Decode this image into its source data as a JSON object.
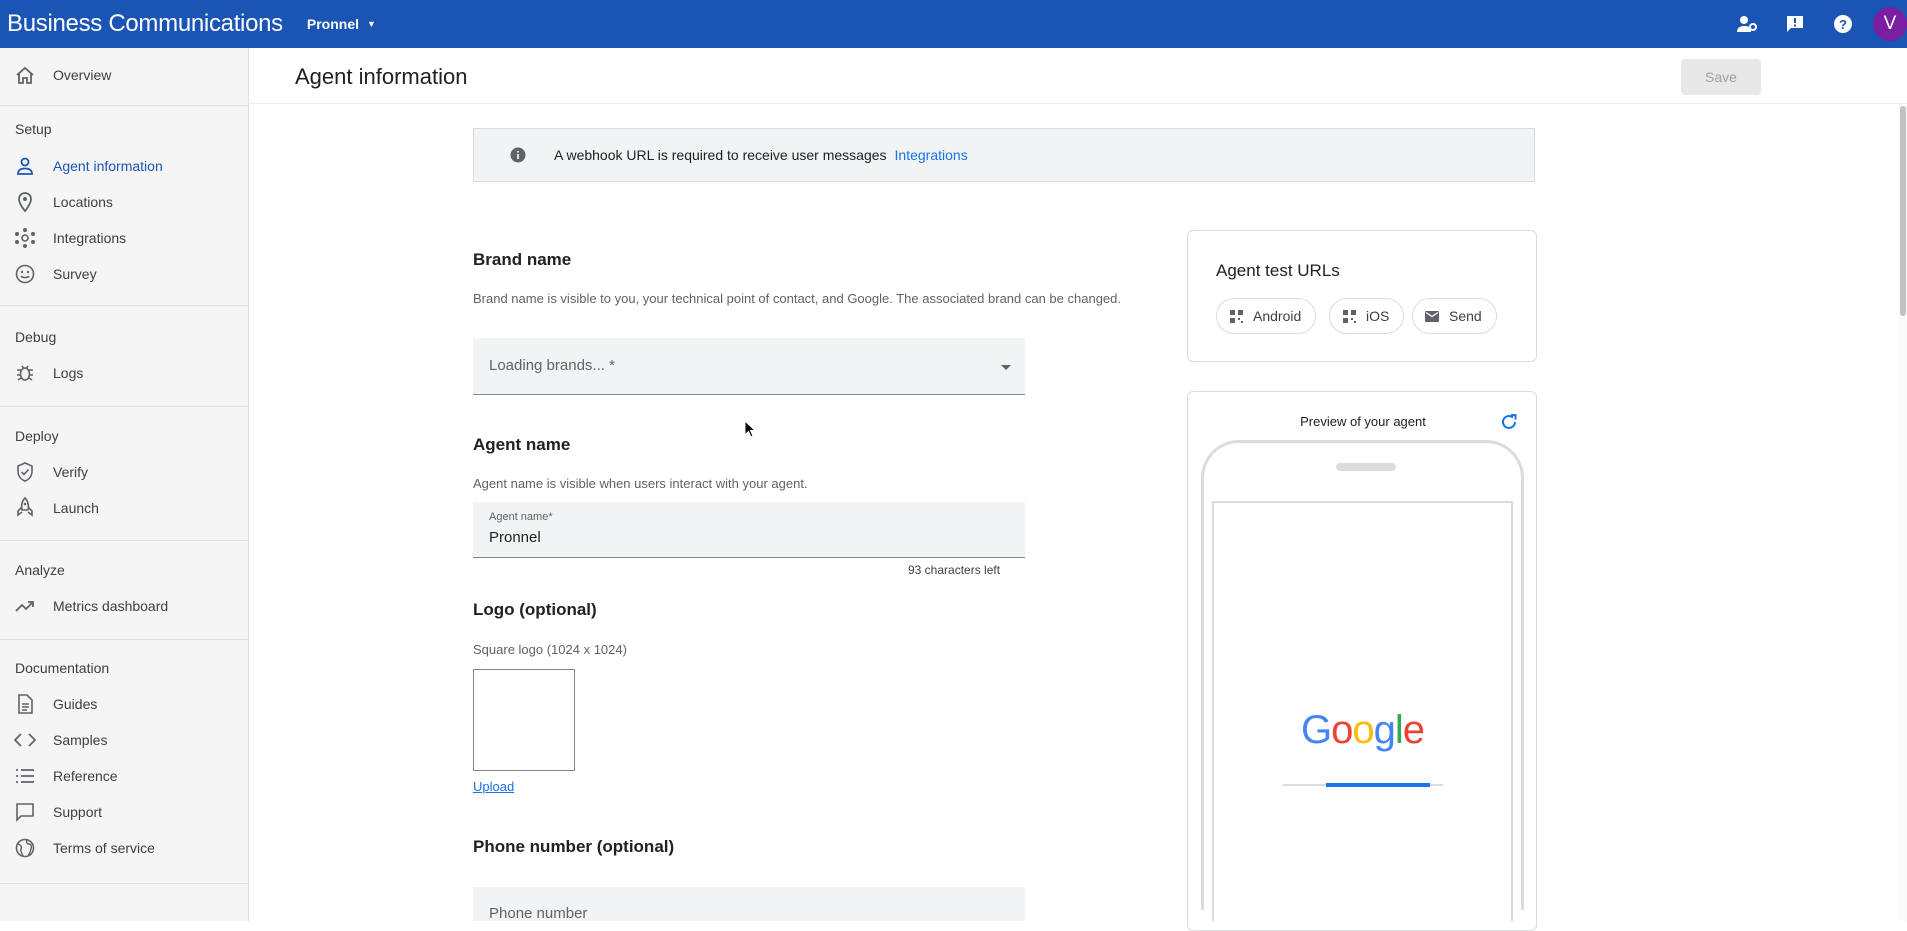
{
  "app": {
    "title": "Business Communications",
    "account": "Pronnel",
    "avatar_letter": "V",
    "brand_color": "#1a55b5",
    "top_icons": [
      "manage-accounts-icon",
      "feedback-icon",
      "help-icon"
    ]
  },
  "sidebar": {
    "overview": "Overview",
    "setup_header": "Setup",
    "setup_items": [
      "Agent information",
      "Locations",
      "Integrations",
      "Survey"
    ],
    "debug_header": "Debug",
    "debug_items": [
      "Logs"
    ],
    "deploy_header": "Deploy",
    "deploy_items": [
      "Verify",
      "Launch"
    ],
    "analyze_header": "Analyze",
    "analyze_items": [
      "Metrics dashboard"
    ],
    "docs_header": "Documentation",
    "docs_items": [
      "Guides",
      "Samples",
      "Reference",
      "Support",
      "Terms of service"
    ],
    "active_item": "Agent information"
  },
  "header": {
    "title": "Agent information",
    "save_label": "Save"
  },
  "banner": {
    "message": "A webhook URL is required to receive user messages",
    "link": "Integrations"
  },
  "brand": {
    "heading": "Brand name",
    "description": "Brand name is visible to you, your technical point of contact, and Google. The associated brand can be changed.",
    "placeholder": "Loading brands... *"
  },
  "agent_name": {
    "heading": "Agent name",
    "description": "Agent name is visible when users interact with your agent.",
    "label": "Agent name*",
    "value": "Pronnel",
    "counter": "93 characters left"
  },
  "logo": {
    "heading": "Logo (optional)",
    "subheading": "Square logo (1024 x 1024)",
    "upload": "Upload"
  },
  "phone": {
    "heading": "Phone number (optional)",
    "placeholder": "Phone number"
  },
  "test_urls": {
    "title": "Agent test URLs",
    "chips": [
      "Android",
      "iOS",
      "Send"
    ]
  },
  "preview": {
    "title": "Preview of your agent",
    "google_letters": [
      "G",
      "o",
      "o",
      "g",
      "l",
      "e"
    ],
    "google_colors": [
      "#4285f4",
      "#ea4335",
      "#fbbc05",
      "#4285f4",
      "#34a853",
      "#ea4335"
    ]
  }
}
